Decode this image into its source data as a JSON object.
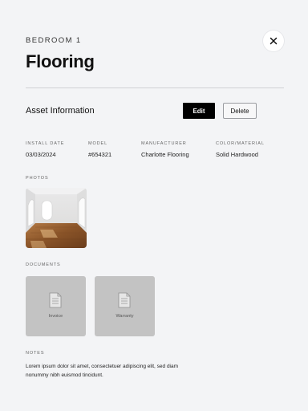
{
  "header": {
    "eyebrow": "BEDROOM 1",
    "title": "Flooring",
    "close_icon": "close-icon"
  },
  "asset_section": {
    "heading": "Asset Information",
    "edit_label": "Edit",
    "delete_label": "Delete"
  },
  "details": [
    {
      "label": "INSTALL DATE",
      "value": "03/03/2024"
    },
    {
      "label": "MODEL",
      "value": "#654321"
    },
    {
      "label": "MANUFACTURER",
      "value": "Charlotte Flooring"
    },
    {
      "label": "COLOR/MATERIAL",
      "value": "Solid Hardwood"
    }
  ],
  "photos": {
    "heading": "PHOTOS",
    "items": [
      "room-photo"
    ]
  },
  "documents": {
    "heading": "DOCUMENTS",
    "icon": "document-icon",
    "items": [
      {
        "label": "Invoice"
      },
      {
        "label": "Warranty"
      }
    ]
  },
  "notes": {
    "heading": "NOTES",
    "text": "Lorem ipsum dolor sit amet, consectetuer adipiscing elit, sed diam nonummy nibh euismod tincidunt."
  },
  "colors": {
    "background": "#f3f4f6",
    "primary_button": "#000000",
    "document_card": "#c3c3c3"
  }
}
